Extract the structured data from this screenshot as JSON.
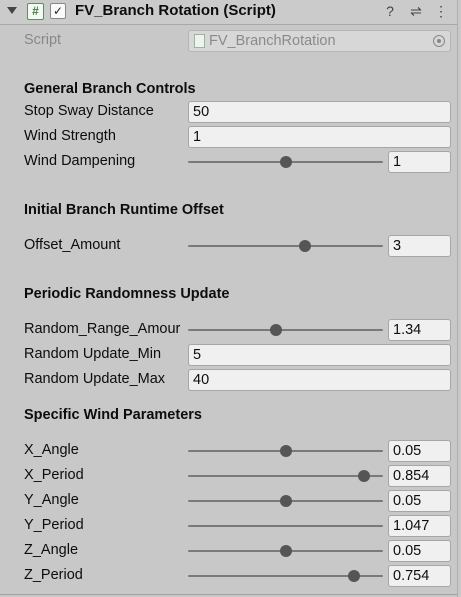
{
  "header": {
    "script_badge": "#",
    "enabled_check": "✓",
    "title": "FV_Branch Rotation (Script)",
    "icons": [
      "help-icon",
      "preset-icon",
      "more-icon"
    ],
    "help_glyph": "?",
    "preset_glyph": "⇌",
    "more_glyph": "⋮"
  },
  "script_field": {
    "label": "Script",
    "value": "FV_BranchRotation"
  },
  "general": {
    "heading": "General Branch Controls",
    "stop_sway_label": "Stop Sway Distance",
    "stop_sway_value": "50",
    "wind_strength_label": "Wind Strength",
    "wind_strength_value": "1",
    "wind_dampening_label": "Wind Dampening",
    "wind_dampening_value": "1",
    "wind_dampening_fraction": 0.5
  },
  "offset": {
    "heading": "Initial Branch Runtime Offset",
    "amount_label": "Offset_Amount",
    "amount_value": "3",
    "amount_fraction": 0.6
  },
  "periodic": {
    "heading": "Periodic Randomness Update",
    "range_label": "Random_Range_Amour",
    "range_value": "1.34",
    "range_fraction": 0.45,
    "min_label": "Random Update_Min",
    "min_value": "5",
    "max_label": "Random Update_Max",
    "max_value": "40"
  },
  "wind": {
    "heading": "Specific Wind Parameters",
    "params": [
      {
        "label": "X_Angle",
        "value": "0.05",
        "fraction": 0.5
      },
      {
        "label": "X_Period",
        "value": "0.854",
        "fraction": 0.9
      },
      {
        "label": "Y_Angle",
        "value": "0.05",
        "fraction": 0.5
      },
      {
        "label": "Y_Period",
        "value": "1.047",
        "fraction": null
      },
      {
        "label": "Z_Angle",
        "value": "0.05",
        "fraction": 0.5
      },
      {
        "label": "Z_Period",
        "value": "0.754",
        "fraction": 0.85
      }
    ]
  }
}
